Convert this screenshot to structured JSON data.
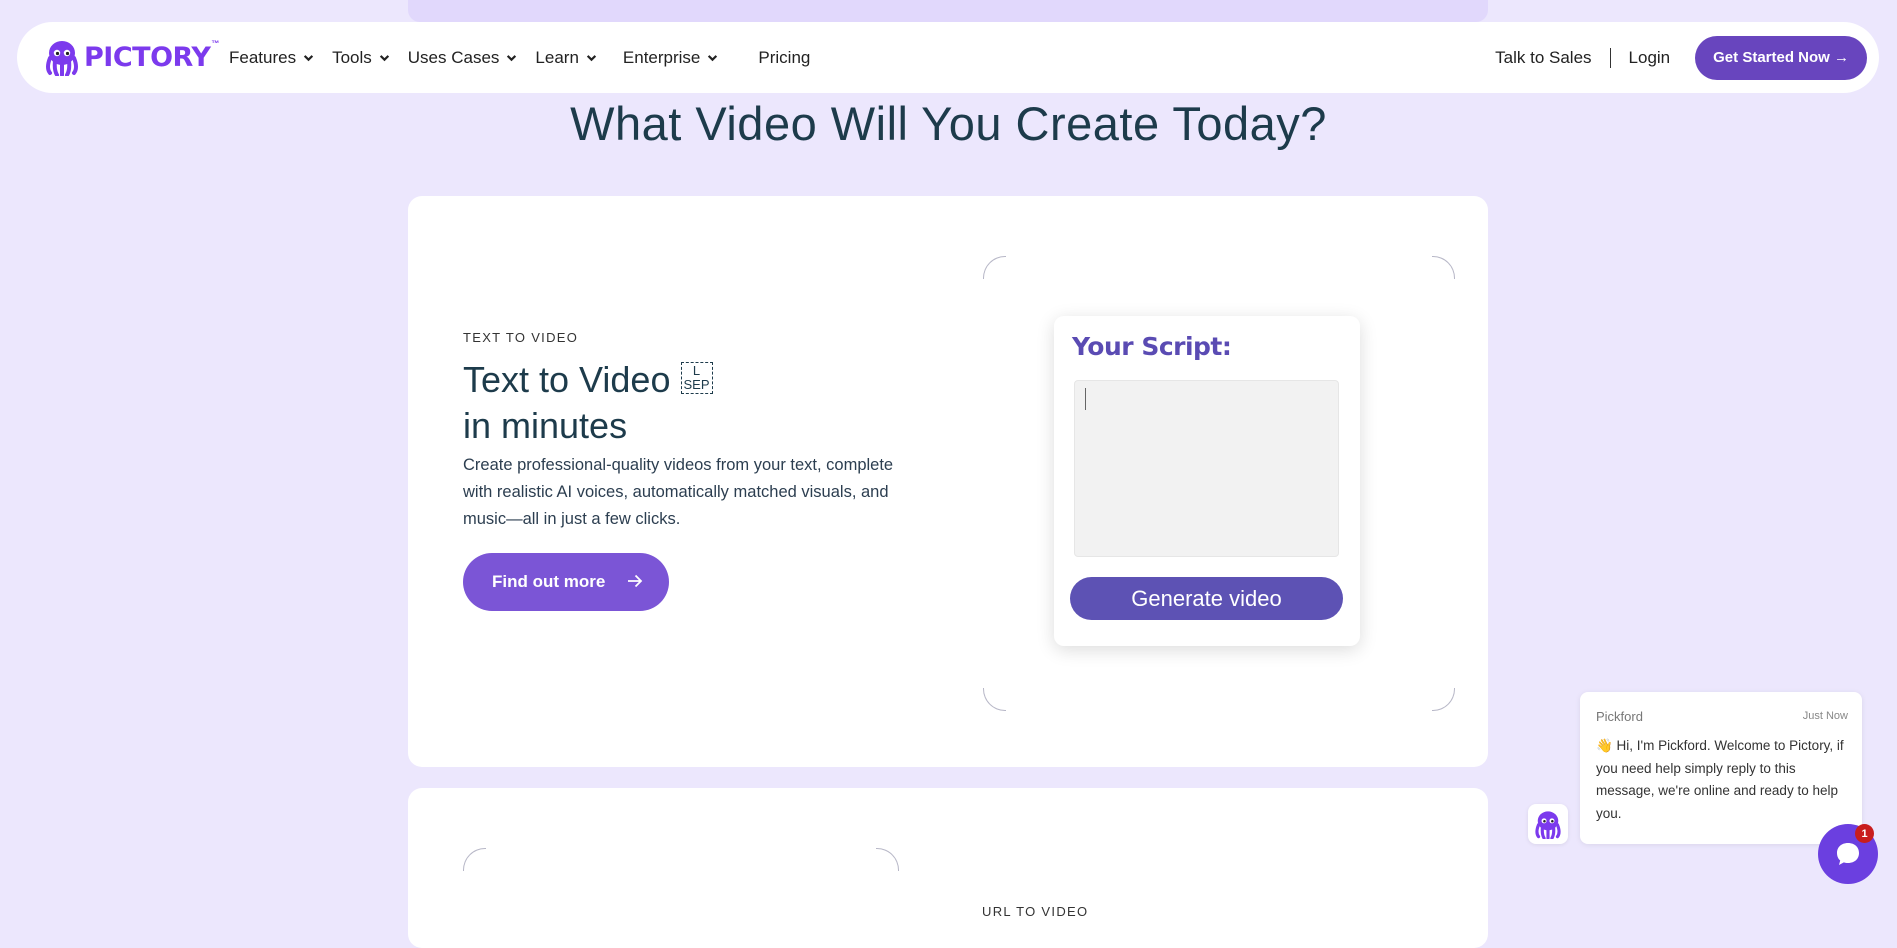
{
  "brand": {
    "name": "PICTORY",
    "tm": "™"
  },
  "nav": {
    "items": [
      {
        "label": "Features",
        "icon": "chevron-down-icon"
      },
      {
        "label": "Tools",
        "icon": "chevron-down-icon"
      },
      {
        "label": "Uses Cases",
        "icon": "chevron-down-icon"
      },
      {
        "label": "Learn",
        "icon": "chevron-down-icon"
      },
      {
        "label": "Enterprise",
        "icon": "chevron-down-icon"
      },
      {
        "label": "Pricing"
      }
    ],
    "talk_to_sales": "Talk to Sales",
    "login": "Login",
    "cta": "Get Started Now →"
  },
  "headline": "What Video Will You Create Today?",
  "card1": {
    "eyebrow": "TEXT TO VIDEO",
    "title_line1": "Text to Video",
    "sep_top": "L",
    "sep_bottom": "SEP",
    "title_line2": "in minutes",
    "description": "Create professional-quality videos from your text, complete with realistic AI voices, automatically matched visuals, and music—all in just a few clicks.",
    "button": "Find out more",
    "button_icon": "arrow-right-icon",
    "panel": {
      "title": "Your Script:",
      "textarea_value": "",
      "generate_button": "Generate video"
    }
  },
  "card2": {
    "eyebrow": "URL TO VIDEO"
  },
  "chat": {
    "name": "Pickford",
    "time": "Just Now",
    "message": "👋 Hi, I'm Pickford. Welcome to Pictory, if you need help simply reply to this message, we're online and ready to help you.",
    "badge": "1"
  },
  "colors": {
    "page_bg": "#ece7fd",
    "brand_purple": "#7c3aed",
    "cta": "#6845be",
    "find_button": "#7b55d6",
    "generate_button": "#5d52b4",
    "chat_launcher": "#6b3fe0",
    "badge": "#c91d1d"
  }
}
